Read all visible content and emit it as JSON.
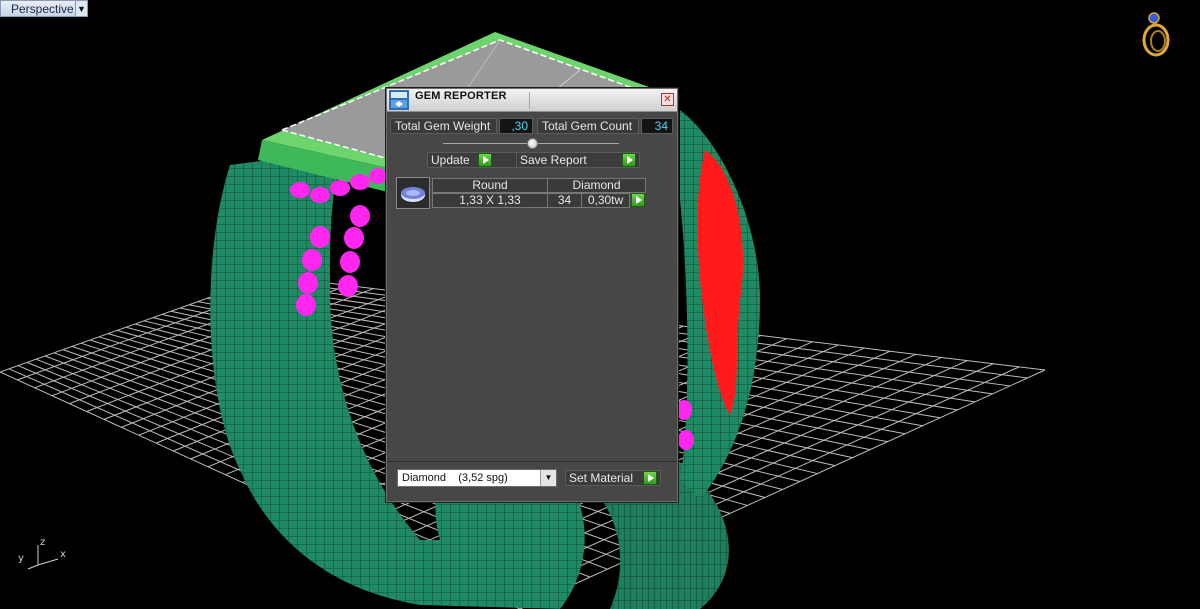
{
  "viewport": {
    "label": "Perspective",
    "axes": {
      "x": "x",
      "y": "y",
      "z": "z"
    }
  },
  "gem_reporter": {
    "title": "GEM REPORTER",
    "close_symbol": "✕",
    "total_weight_label": "Total Gem Weight",
    "total_weight_value": ",30",
    "total_count_label": "Total Gem Count",
    "total_count_value": "34",
    "update_label": "Update",
    "save_report_label": "Save Report",
    "gems": [
      {
        "shape": "Round",
        "material": "Diamond",
        "size": "1,33 X 1,33",
        "count": "34",
        "weight": "0,30tw"
      }
    ],
    "material_select": {
      "name": "Diamond",
      "spec": "(3,52 spg)"
    },
    "set_material_label": "Set Material"
  },
  "colors": {
    "background": "#000000",
    "grid": "#bdbdbd",
    "ring": "#1f8a63",
    "gems_magenta": "#ff27f0",
    "gems_red": "#ff1b1b",
    "panel": "#474747",
    "value_text": "#4ad6ee",
    "accent_green": "#3fae2a"
  }
}
